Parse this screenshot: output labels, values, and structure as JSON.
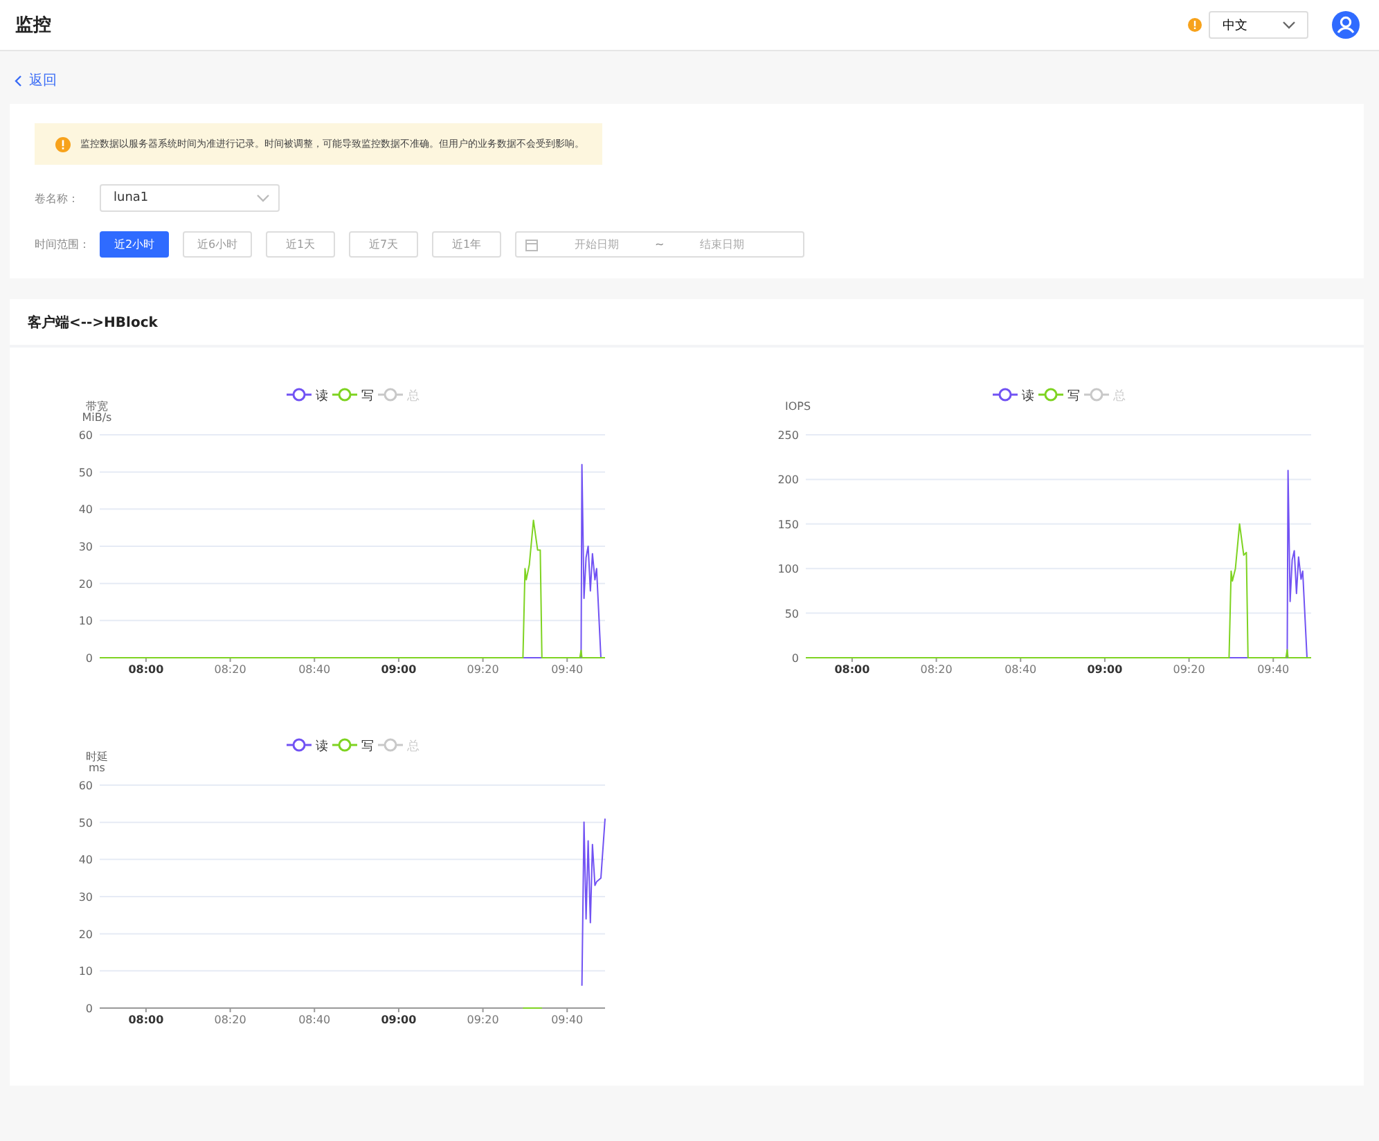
{
  "header": {
    "title": "监控",
    "language": "中文"
  },
  "back_link": "返回",
  "notice": "监控数据以服务器系统时间为准进行记录。时间被调整，可能导致监控数据不准确。但用户的业务数据不会受到影响。",
  "volume": {
    "label": "卷名称：",
    "value": "luna1"
  },
  "time_range": {
    "label": "时间范围：",
    "options": [
      {
        "label": "近2小时",
        "selected": true
      },
      {
        "label": "近6小时",
        "selected": false
      },
      {
        "label": "近1天",
        "selected": false
      },
      {
        "label": "近7天",
        "selected": false
      },
      {
        "label": "近1年",
        "selected": false
      }
    ],
    "start_placeholder": "开始日期",
    "separator": "~",
    "end_placeholder": "结束日期"
  },
  "section": {
    "title": "客户端<-->HBlock",
    "charts": [
      {
        "unit": "MiB/s",
        "legend_on": [
          true,
          true,
          false
        ],
        "chart_data": {
          "type": "line",
          "ylabel": "带宽",
          "legend": "top",
          "grid": true,
          "xlim": [
            469,
            589
          ],
          "ylim": [
            0,
            60
          ],
          "yticks": [
            0,
            10,
            20,
            30,
            40,
            50,
            60
          ],
          "xticks": [
            {
              "value": 480,
              "label": "08:00"
            },
            {
              "value": 500,
              "label": "08:20"
            },
            {
              "value": 520,
              "label": "08:40"
            },
            {
              "value": 540,
              "label": "09:00"
            },
            {
              "value": 560,
              "label": "09:20"
            },
            {
              "value": 580,
              "label": "09:40"
            }
          ],
          "x": [
            469,
            569.5,
            570,
            570.3,
            571,
            572,
            573,
            573.6,
            574,
            583,
            583.3,
            583.5,
            584,
            584.5,
            585,
            585.5,
            586,
            586.6,
            587,
            588,
            589
          ],
          "series": [
            {
              "name": "读",
              "color": "#7152f3",
              "values": [
                0,
                0,
                0,
                0,
                0,
                0,
                0,
                0,
                0,
                0,
                0,
                52,
                16,
                27,
                30,
                18,
                28,
                21,
                24,
                0,
                0
              ]
            },
            {
              "name": "写",
              "color": "#7ed321",
              "values": [
                0,
                0,
                24,
                21,
                25,
                37,
                29,
                29,
                0,
                0,
                2,
                0,
                0,
                0,
                0,
                0,
                0,
                0,
                0,
                0,
                0
              ]
            },
            {
              "name": "总",
              "color": "#c8c8c8",
              "values": [
                null,
                null,
                null,
                null,
                null,
                null,
                null,
                null,
                null,
                null,
                null,
                null,
                null,
                null,
                null,
                null,
                null,
                null,
                null,
                null,
                null
              ]
            }
          ]
        }
      },
      {
        "legend_on": [
          true,
          true,
          false
        ],
        "chart_data": {
          "type": "line",
          "ylabel": "IOPS",
          "legend": "top",
          "grid": true,
          "xlim": [
            469,
            589
          ],
          "ylim": [
            0,
            250
          ],
          "yticks": [
            0,
            50,
            100,
            150,
            200,
            250
          ],
          "xticks": [
            {
              "value": 480,
              "label": "08:00"
            },
            {
              "value": 500,
              "label": "08:20"
            },
            {
              "value": 520,
              "label": "08:40"
            },
            {
              "value": 540,
              "label": "09:00"
            },
            {
              "value": 560,
              "label": "09:20"
            },
            {
              "value": 580,
              "label": "09:40"
            }
          ],
          "x": [
            469,
            569.5,
            570,
            570.3,
            571,
            572,
            573,
            573.6,
            574,
            583,
            583.3,
            583.5,
            584,
            584.5,
            585,
            585.5,
            586,
            586.6,
            587,
            588,
            589
          ],
          "series": [
            {
              "name": "读",
              "color": "#7152f3",
              "values": [
                0,
                0,
                0,
                0,
                0,
                0,
                0,
                0,
                0,
                0,
                0,
                210,
                63,
                110,
                120,
                72,
                113,
                88,
                97,
                0,
                0
              ]
            },
            {
              "name": "写",
              "color": "#7ed321",
              "values": [
                0,
                0,
                97,
                86,
                100,
                150,
                115,
                118,
                0,
                0,
                9,
                0,
                0,
                0,
                0,
                0,
                0,
                0,
                0,
                0,
                0
              ]
            },
            {
              "name": "总",
              "color": "#c8c8c8",
              "values": [
                null,
                null,
                null,
                null,
                null,
                null,
                null,
                null,
                null,
                null,
                null,
                null,
                null,
                null,
                null,
                null,
                null,
                null,
                null,
                null,
                null
              ]
            }
          ]
        }
      },
      {
        "unit": "ms",
        "legend_on": [
          true,
          true,
          false
        ],
        "chart_data": {
          "type": "line",
          "ylabel": "时延",
          "legend": "top",
          "grid": true,
          "xlim": [
            469,
            589
          ],
          "ylim": [
            0,
            60
          ],
          "yticks": [
            0,
            10,
            20,
            30,
            40,
            50,
            60
          ],
          "xticks": [
            {
              "value": 480,
              "label": "08:00"
            },
            {
              "value": 500,
              "label": "08:20"
            },
            {
              "value": 520,
              "label": "08:40"
            },
            {
              "value": 540,
              "label": "09:00"
            },
            {
              "value": 560,
              "label": "09:20"
            },
            {
              "value": 580,
              "label": "09:40"
            }
          ],
          "x": [
            569.5,
            570,
            571,
            572,
            573,
            574,
            583.5,
            584,
            584.5,
            585,
            585.5,
            586,
            586.6,
            587,
            588,
            589
          ],
          "series": [
            {
              "name": "读",
              "color": "#7152f3",
              "values": [
                null,
                null,
                null,
                null,
                null,
                null,
                6,
                50,
                24,
                45,
                23,
                44,
                33,
                34,
                35,
                51
              ]
            },
            {
              "name": "写",
              "color": "#7ed321",
              "values": [
                0,
                0,
                0,
                0,
                0,
                0,
                null,
                null,
                null,
                null,
                null,
                null,
                null,
                null,
                null,
                null
              ]
            },
            {
              "name": "总",
              "color": "#c8c8c8",
              "values": [
                null,
                null,
                null,
                null,
                null,
                null,
                null,
                null,
                null,
                null,
                null,
                null,
                null,
                null,
                null,
                null
              ]
            }
          ]
        }
      }
    ]
  }
}
